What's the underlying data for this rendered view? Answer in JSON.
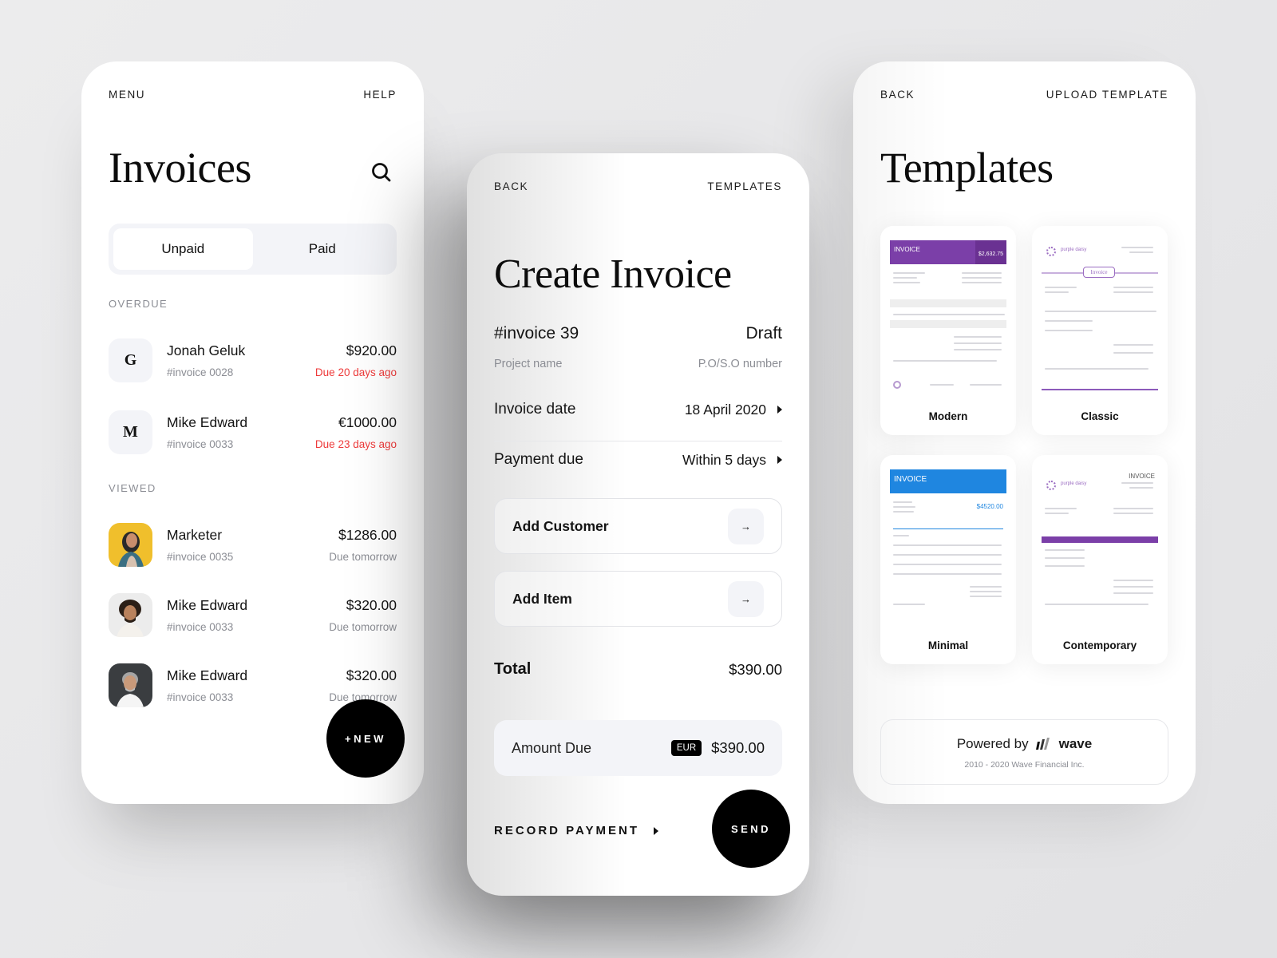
{
  "invoices_screen": {
    "nav": {
      "left": "MENU",
      "right": "HELP"
    },
    "title": "Invoices",
    "search_icon": "search-icon",
    "tabs": [
      {
        "label": "Unpaid",
        "active": true
      },
      {
        "label": "Paid",
        "active": false
      }
    ],
    "sections": [
      {
        "label": "OVERDUE",
        "items": [
          {
            "avatar": "G",
            "name": "Jonah Geluk",
            "invoice": "#invoice 0028",
            "amount": "$920.00",
            "status": "Due 20 days ago",
            "overdue": true
          },
          {
            "avatar": "M",
            "name": "Mike Edward",
            "invoice": "#invoice 0033",
            "amount": "€1000.00",
            "status": "Due 23 days ago",
            "overdue": true
          }
        ]
      },
      {
        "label": "VIEWED",
        "items": [
          {
            "avatar": "photo-woman-yellow",
            "name": "Marketer",
            "invoice": "#invoice 0035",
            "amount": "$1286.00",
            "status": "Due tomorrow",
            "overdue": false
          },
          {
            "avatar": "photo-man-curly",
            "name": "Mike Edward",
            "invoice": "#invoice 0033",
            "amount": "$320.00",
            "status": "Due tomorrow",
            "overdue": false
          },
          {
            "avatar": "photo-man-grey",
            "name": "Mike Edward",
            "invoice": "#invoice 0033",
            "amount": "$320.00",
            "status": "Due tomorrow",
            "overdue": false
          }
        ]
      }
    ],
    "fab_label": "+NEW"
  },
  "create_screen": {
    "nav": {
      "left": "BACK",
      "right": "TEMPLATES"
    },
    "title": "Create Invoice",
    "invoice_number": "#invoice 39",
    "invoice_state": "Draft",
    "project_name_placeholder": "Project name",
    "po_placeholder": "P.O/S.O number",
    "fields": [
      {
        "label": "Invoice date",
        "value": "18 April 2020"
      },
      {
        "label": "Payment due",
        "value": "Within 5 days"
      }
    ],
    "add_customer": "Add Customer",
    "add_item": "Add Item",
    "arrow_glyph": "→",
    "total_label": "Total",
    "total_value": "$390.00",
    "amount_due_label": "Amount Due",
    "currency": "EUR",
    "amount_due_value": "$390.00",
    "record_payment": "RECORD PAYMENT",
    "send": "SEND"
  },
  "templates_screen": {
    "nav": {
      "left": "BACK",
      "right": "UPLOAD TEMPLATE"
    },
    "title": "Templates",
    "templates": [
      {
        "name": "Modern",
        "header_text": "INVOICE",
        "amount": "$2,632.75",
        "accent": "#7b3fa8"
      },
      {
        "name": "Classic",
        "header_text": "Invoice",
        "brand": "purple daisy",
        "accent": "#9b6dc2"
      },
      {
        "name": "Minimal",
        "header_text": "INVOICE",
        "amount": "$4520.00",
        "accent": "#1f86e0"
      },
      {
        "name": "Contemporary",
        "header_text": "INVOICE",
        "brand": "purple daisy",
        "accent": "#7b3fa8"
      }
    ],
    "powered_by": "Powered by",
    "brand_name": "wave",
    "copyright": "2010 - 2020 Wave Financial Inc."
  },
  "colors": {
    "overdue": "#ee3b3b",
    "muted": "#8b8d94",
    "surface": "#f3f4f8",
    "fab": "#000000"
  }
}
